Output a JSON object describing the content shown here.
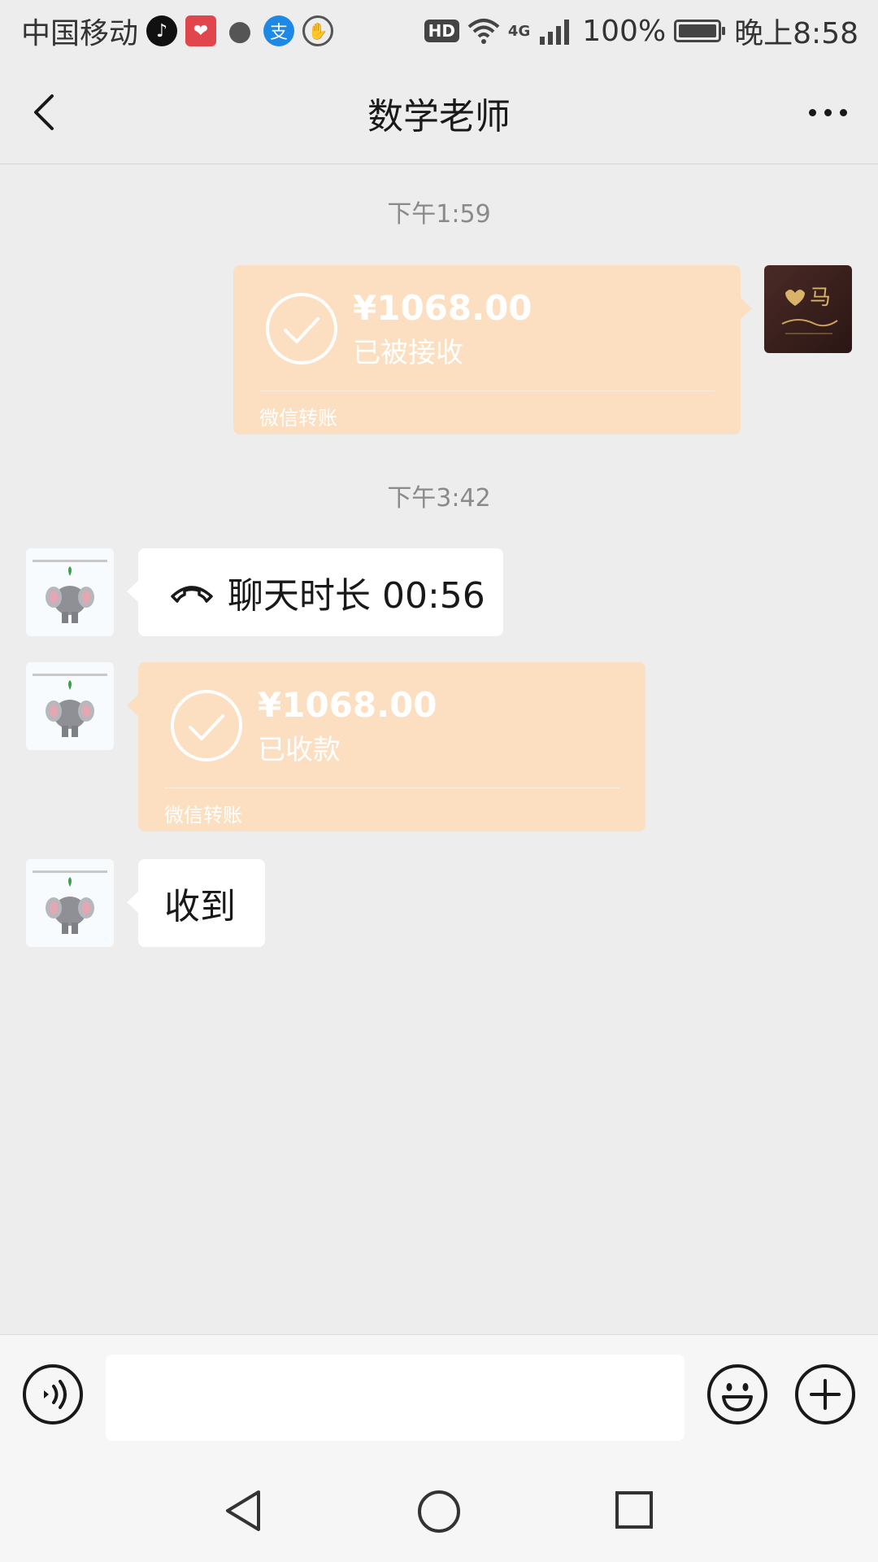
{
  "status_bar": {
    "carrier": "中国移动",
    "hd": "HD",
    "network": "4G",
    "battery": "100%",
    "time": "晚上8:58"
  },
  "header": {
    "title": "数学老师"
  },
  "messages": [
    {
      "timestamp": "下午1:59"
    },
    {
      "type": "transfer",
      "side": "right",
      "amount": "¥1068.00",
      "status": "已被接收",
      "label": "微信转账"
    },
    {
      "timestamp": "下午3:42"
    },
    {
      "type": "call",
      "side": "left",
      "text": "聊天时长 00:56"
    },
    {
      "type": "transfer",
      "side": "left",
      "amount": "¥1068.00",
      "status": "已收款",
      "label": "微信转账"
    },
    {
      "type": "text",
      "side": "left",
      "text": "收到"
    }
  ],
  "input_bar": {
    "placeholder": ""
  },
  "icons": {
    "back": "back-icon",
    "more": "more-icon",
    "voice": "voice-icon",
    "emoji": "emoji-icon",
    "plus": "plus-icon",
    "call": "phone-hangup-icon"
  },
  "colors": {
    "background": "#ededed",
    "transfer_bubble": "#fbdfc0",
    "incoming_bubble": "#ffffff"
  }
}
